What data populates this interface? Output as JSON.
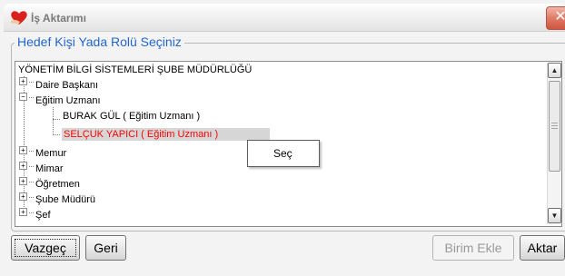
{
  "window": {
    "title": "İş Aktarımı",
    "close_glyph": "✕",
    "app_icon": "red-heart-hand-icon"
  },
  "group": {
    "title": "Hedef Kişi Yada Rolü Seçiniz"
  },
  "tree": {
    "root": "YÖNETİM BİLGİ SİSTEMLERİ ŞUBE MÜDÜRLÜĞÜ",
    "nodes": [
      {
        "label": "Daire Başkanı",
        "expander": "+"
      },
      {
        "label": "Eğitim Uzmanı",
        "expander": "−"
      },
      {
        "label": "BURAK GÜL ( Eğitim Uzmanı )"
      },
      {
        "label": "SELÇUK YAPICI ( Eğitim Uzmanı )",
        "color": "#ff0000"
      },
      {
        "label": "Memur",
        "expander": "+"
      },
      {
        "label": "Mimar",
        "expander": "+"
      },
      {
        "label": "Öğretmen",
        "expander": "+"
      },
      {
        "label": "Şube Müdürü",
        "expander": "+"
      },
      {
        "label": "Şef",
        "expander": "+"
      }
    ],
    "scroll_up": "▲",
    "scroll_down": "▼"
  },
  "context_menu": {
    "item": "Seç"
  },
  "buttons": {
    "cancel": "Vazgeç",
    "back": "Geri",
    "add_unit": "Birim Ekle",
    "transfer": "Aktar"
  }
}
